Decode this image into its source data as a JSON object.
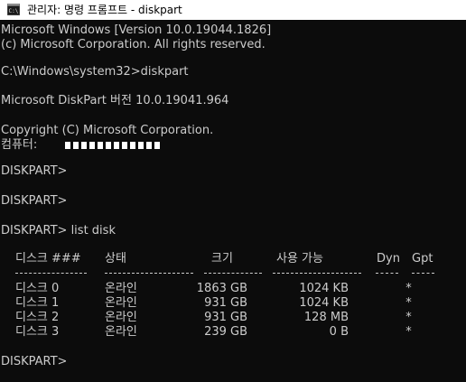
{
  "window": {
    "title": "관리자: 명령 프롬프트 - diskpart",
    "icon": "cmd-icon"
  },
  "console": {
    "lines": [
      "Microsoft Windows [Version 10.0.19044.1826]",
      "(c) Microsoft Corporation. All rights reserved.",
      "",
      "C:\\Windows\\system32>diskpart",
      "",
      "Microsoft DiskPart 버전 10.0.19041.964",
      "",
      "Copyright (C) Microsoft Corporation.",
      "컴퓨터:",
      "",
      "DISKPART>",
      "",
      "DISKPART>",
      "",
      "DISKPART> list disk"
    ],
    "final_prompt": "DISKPART>"
  },
  "disk_table": {
    "headers": [
      "디스크 ###",
      "상태",
      "크기",
      "사용 가능",
      "Dyn",
      "Gpt"
    ],
    "rows": [
      {
        "disk": "디스크 0",
        "status": "온라인",
        "size": "1863 GB",
        "free": "1024 KB",
        "dyn": "",
        "gpt": "*"
      },
      {
        "disk": "디스크 1",
        "status": "온라인",
        "size": "931 GB",
        "free": "1024 KB",
        "dyn": "",
        "gpt": "*"
      },
      {
        "disk": "디스크 2",
        "status": "온라인",
        "size": "931 GB",
        "free": "128 MB",
        "dyn": "",
        "gpt": "*"
      },
      {
        "disk": "디스크 3",
        "status": "온라인",
        "size": "239 GB",
        "free": "0 B",
        "dyn": "",
        "gpt": "*"
      }
    ]
  },
  "colors": {
    "background": "#0c0c0c",
    "text": "#cccccc",
    "titlebar": "#ffffff"
  }
}
